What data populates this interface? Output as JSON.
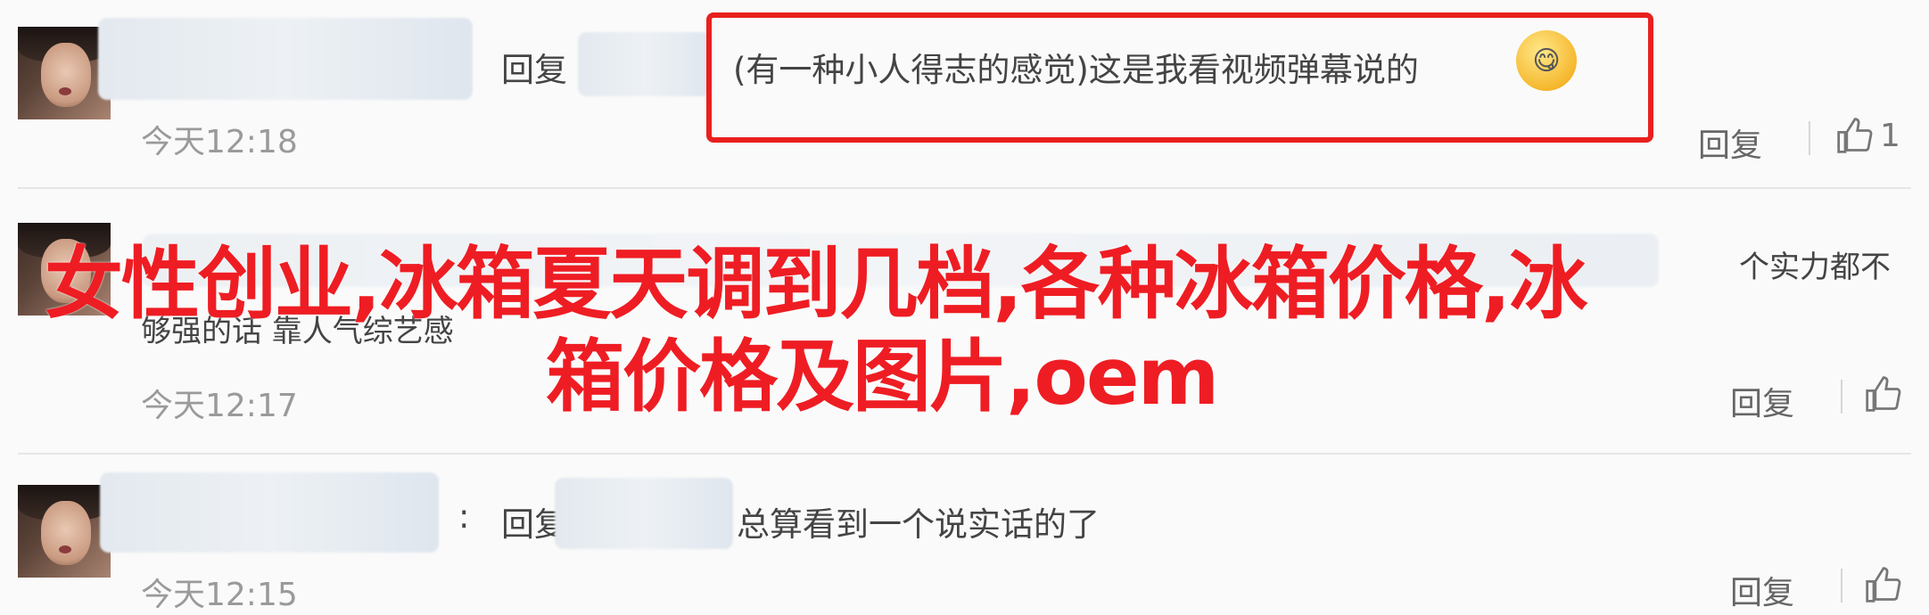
{
  "comments": [
    {
      "reply_prefix": "回复",
      "text": "(有一种小人得志的感觉)这是我看视频弹幕说的",
      "time": "今天12:18",
      "reply_label": "回复",
      "likes": "1"
    },
    {
      "text_line1": "个实力都不",
      "text_line2": "够强的话 靠人气综艺感",
      "time": "今天12:17",
      "reply_label": "回复",
      "likes": ""
    },
    {
      "colon": ":",
      "reply_prefix": "回复",
      "text": "总算看到一个说实话的了",
      "time": "今天12:15",
      "reply_label": "回复"
    }
  ],
  "overlay": {
    "line1": "女性创业,冰箱夏天调到几档,各种冰箱价格,冰",
    "line2": "箱价格及图片,oem",
    "color": "#ee1d23"
  },
  "highlight_color": "#e8201e",
  "emoji": "drooling-smile-emoji"
}
